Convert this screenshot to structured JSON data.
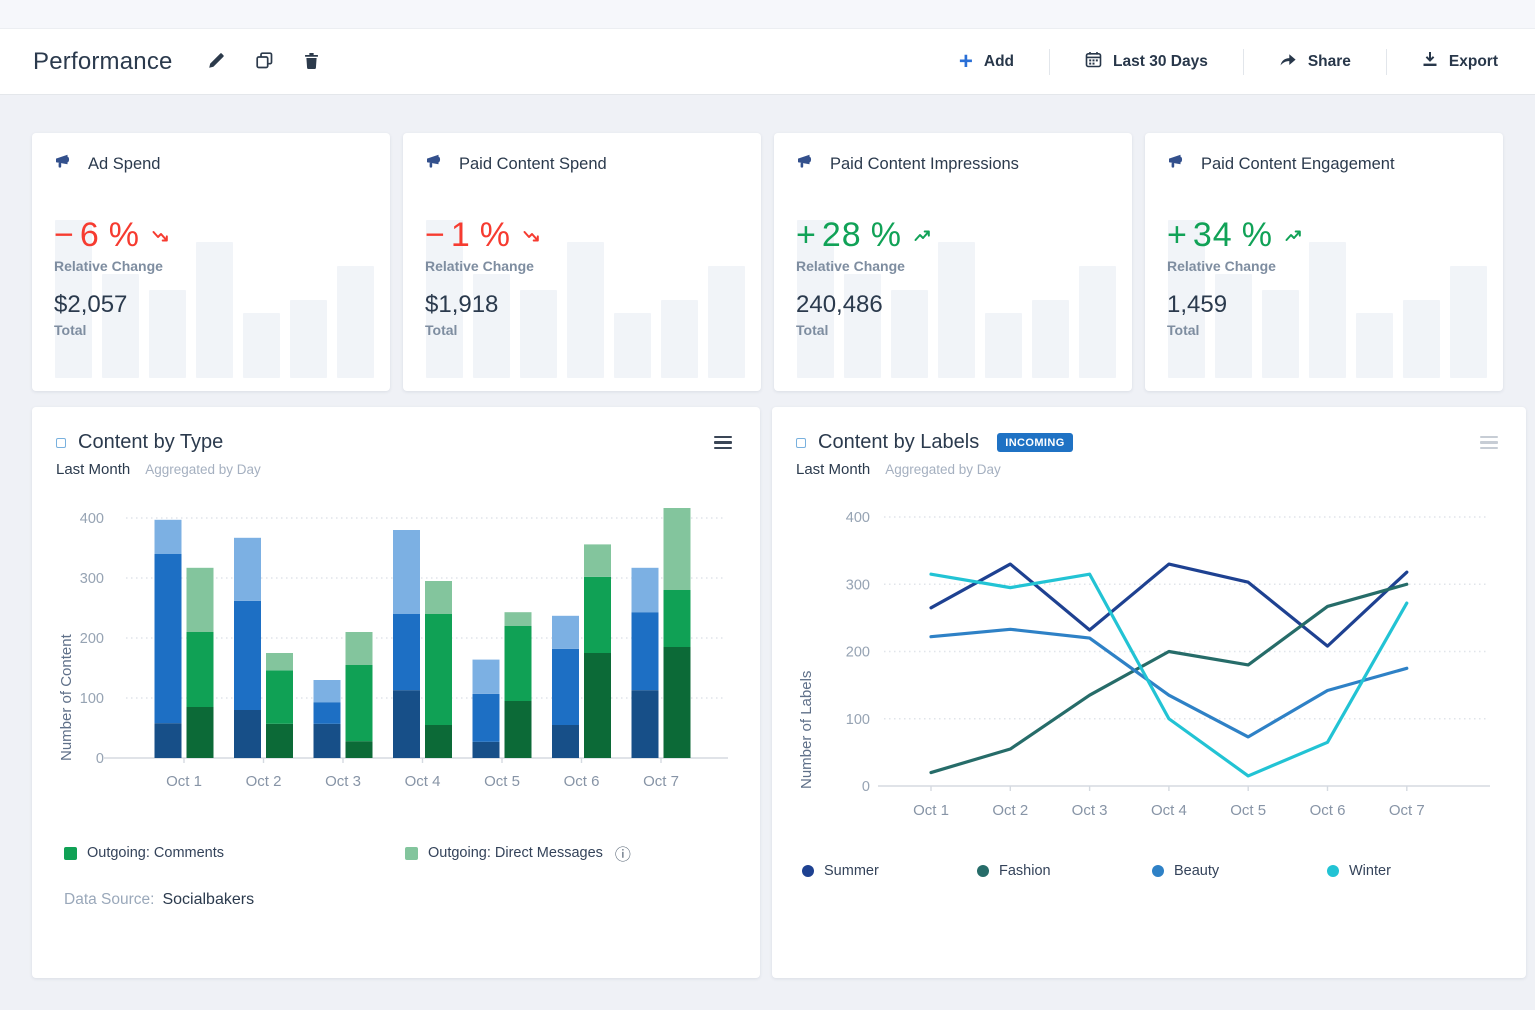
{
  "header": {
    "title": "Performance",
    "add_label": "Add",
    "date_range_label": "Last 30 Days",
    "share_label": "Share",
    "export_label": "Export"
  },
  "labels": {
    "relative_change": "Relative Change",
    "total": "Total"
  },
  "kpi_spark_bars": [
    93,
    61,
    52,
    80,
    38,
    46,
    66
  ],
  "kpi_cards": [
    {
      "title": "Ad Spend",
      "change_sign": "−",
      "change_value": "6",
      "percent": "%",
      "trend": "down",
      "total": "$2,057"
    },
    {
      "title": "Paid Content Spend",
      "change_sign": "−",
      "change_value": "1",
      "percent": "%",
      "trend": "down",
      "total": "$1,918"
    },
    {
      "title": "Paid Content Impressions",
      "change_sign": "+",
      "change_value": "28",
      "percent": "%",
      "trend": "up",
      "total": "240,486"
    },
    {
      "title": "Paid Content Engagement",
      "change_sign": "+",
      "change_value": "34",
      "percent": "%",
      "trend": "up",
      "total": "1,459"
    }
  ],
  "chart_data": [
    {
      "id": "content_by_type",
      "type": "stacked-bar",
      "title": "Content by Type",
      "period": "Last Month",
      "aggregation": "Aggregated by Day",
      "ylabel": "Number of Content",
      "ylim": [
        0,
        400
      ],
      "yticks": [
        0,
        100,
        200,
        300,
        400
      ],
      "grid": "dotted-horizontal",
      "categories": [
        "Oct 1",
        "Oct 2",
        "Oct 3",
        "Oct 4",
        "Oct 5",
        "Oct 6",
        "Oct 7"
      ],
      "bar_groups": [
        {
          "name": "incoming-blue-stack",
          "segments": [
            {
              "name": "blue-dark",
              "color": "#174f88",
              "values": [
                58,
                80,
                57,
                113,
                27,
                55,
                113
              ]
            },
            {
              "name": "blue-mid",
              "color": "#1d6fc4",
              "values": [
                282,
                182,
                36,
                127,
                80,
                127,
                130
              ]
            },
            {
              "name": "blue-light",
              "color": "#7cb0e3",
              "values": [
                57,
                105,
                37,
                140,
                57,
                55,
                74
              ]
            }
          ]
        },
        {
          "name": "outgoing-green-stack",
          "segments": [
            {
              "name": "green-dark",
              "color": "#0c6a37",
              "values": [
                85,
                57,
                28,
                55,
                95,
                175,
                185
              ]
            },
            {
              "name": "green-mid",
              "color": "#10a155",
              "values": [
                125,
                89,
                127,
                185,
                125,
                127,
                95
              ]
            },
            {
              "name": "green-light",
              "color": "#83c59d",
              "values": [
                107,
                29,
                55,
                55,
                23,
                54,
                145
              ]
            }
          ]
        }
      ],
      "legend": [
        {
          "label": "Outgoing: Comments",
          "color": "#10a155",
          "info": false
        },
        {
          "label": "Outgoing: Direct Messages",
          "color": "#83c59d",
          "info": true
        }
      ],
      "info_icon": "ⓘ",
      "data_source_label": "Data Source:",
      "data_source": "Socialbakers"
    },
    {
      "id": "content_by_labels",
      "type": "line",
      "title": "Content by Labels",
      "badge": "INCOMING",
      "period": "Last Month",
      "aggregation": "Aggregated by Day",
      "ylabel": "Number of Labels",
      "ylim": [
        0,
        400
      ],
      "yticks": [
        0,
        100,
        200,
        300,
        400
      ],
      "grid": "dotted-horizontal",
      "legend_position": "bottom",
      "categories": [
        "Oct 1",
        "Oct 2",
        "Oct 3",
        "Oct 4",
        "Oct 5",
        "Oct 6",
        "Oct 7"
      ],
      "series": [
        {
          "name": "Summer",
          "color": "#1e4191",
          "values": [
            265,
            330,
            232,
            330,
            303,
            208,
            318
          ]
        },
        {
          "name": "Fashion",
          "color": "#266c69",
          "values": [
            20,
            55,
            135,
            200,
            180,
            267,
            300
          ]
        },
        {
          "name": "Beauty",
          "color": "#2e81c6",
          "values": [
            222,
            233,
            220,
            135,
            73,
            142,
            175
          ]
        },
        {
          "name": "Winter",
          "color": "#22c3d4",
          "values": [
            315,
            295,
            315,
            100,
            15,
            65,
            272
          ]
        }
      ]
    }
  ],
  "colors": {
    "accent_blue": "#2a6fd6",
    "badge_blue": "#1f72c4",
    "negative_red": "#f63b30",
    "positive_green": "#11a257",
    "kpi_icon_blue": "#33508c",
    "spark_bar": "#f1f4f8",
    "page_background": "#eff1f6"
  }
}
